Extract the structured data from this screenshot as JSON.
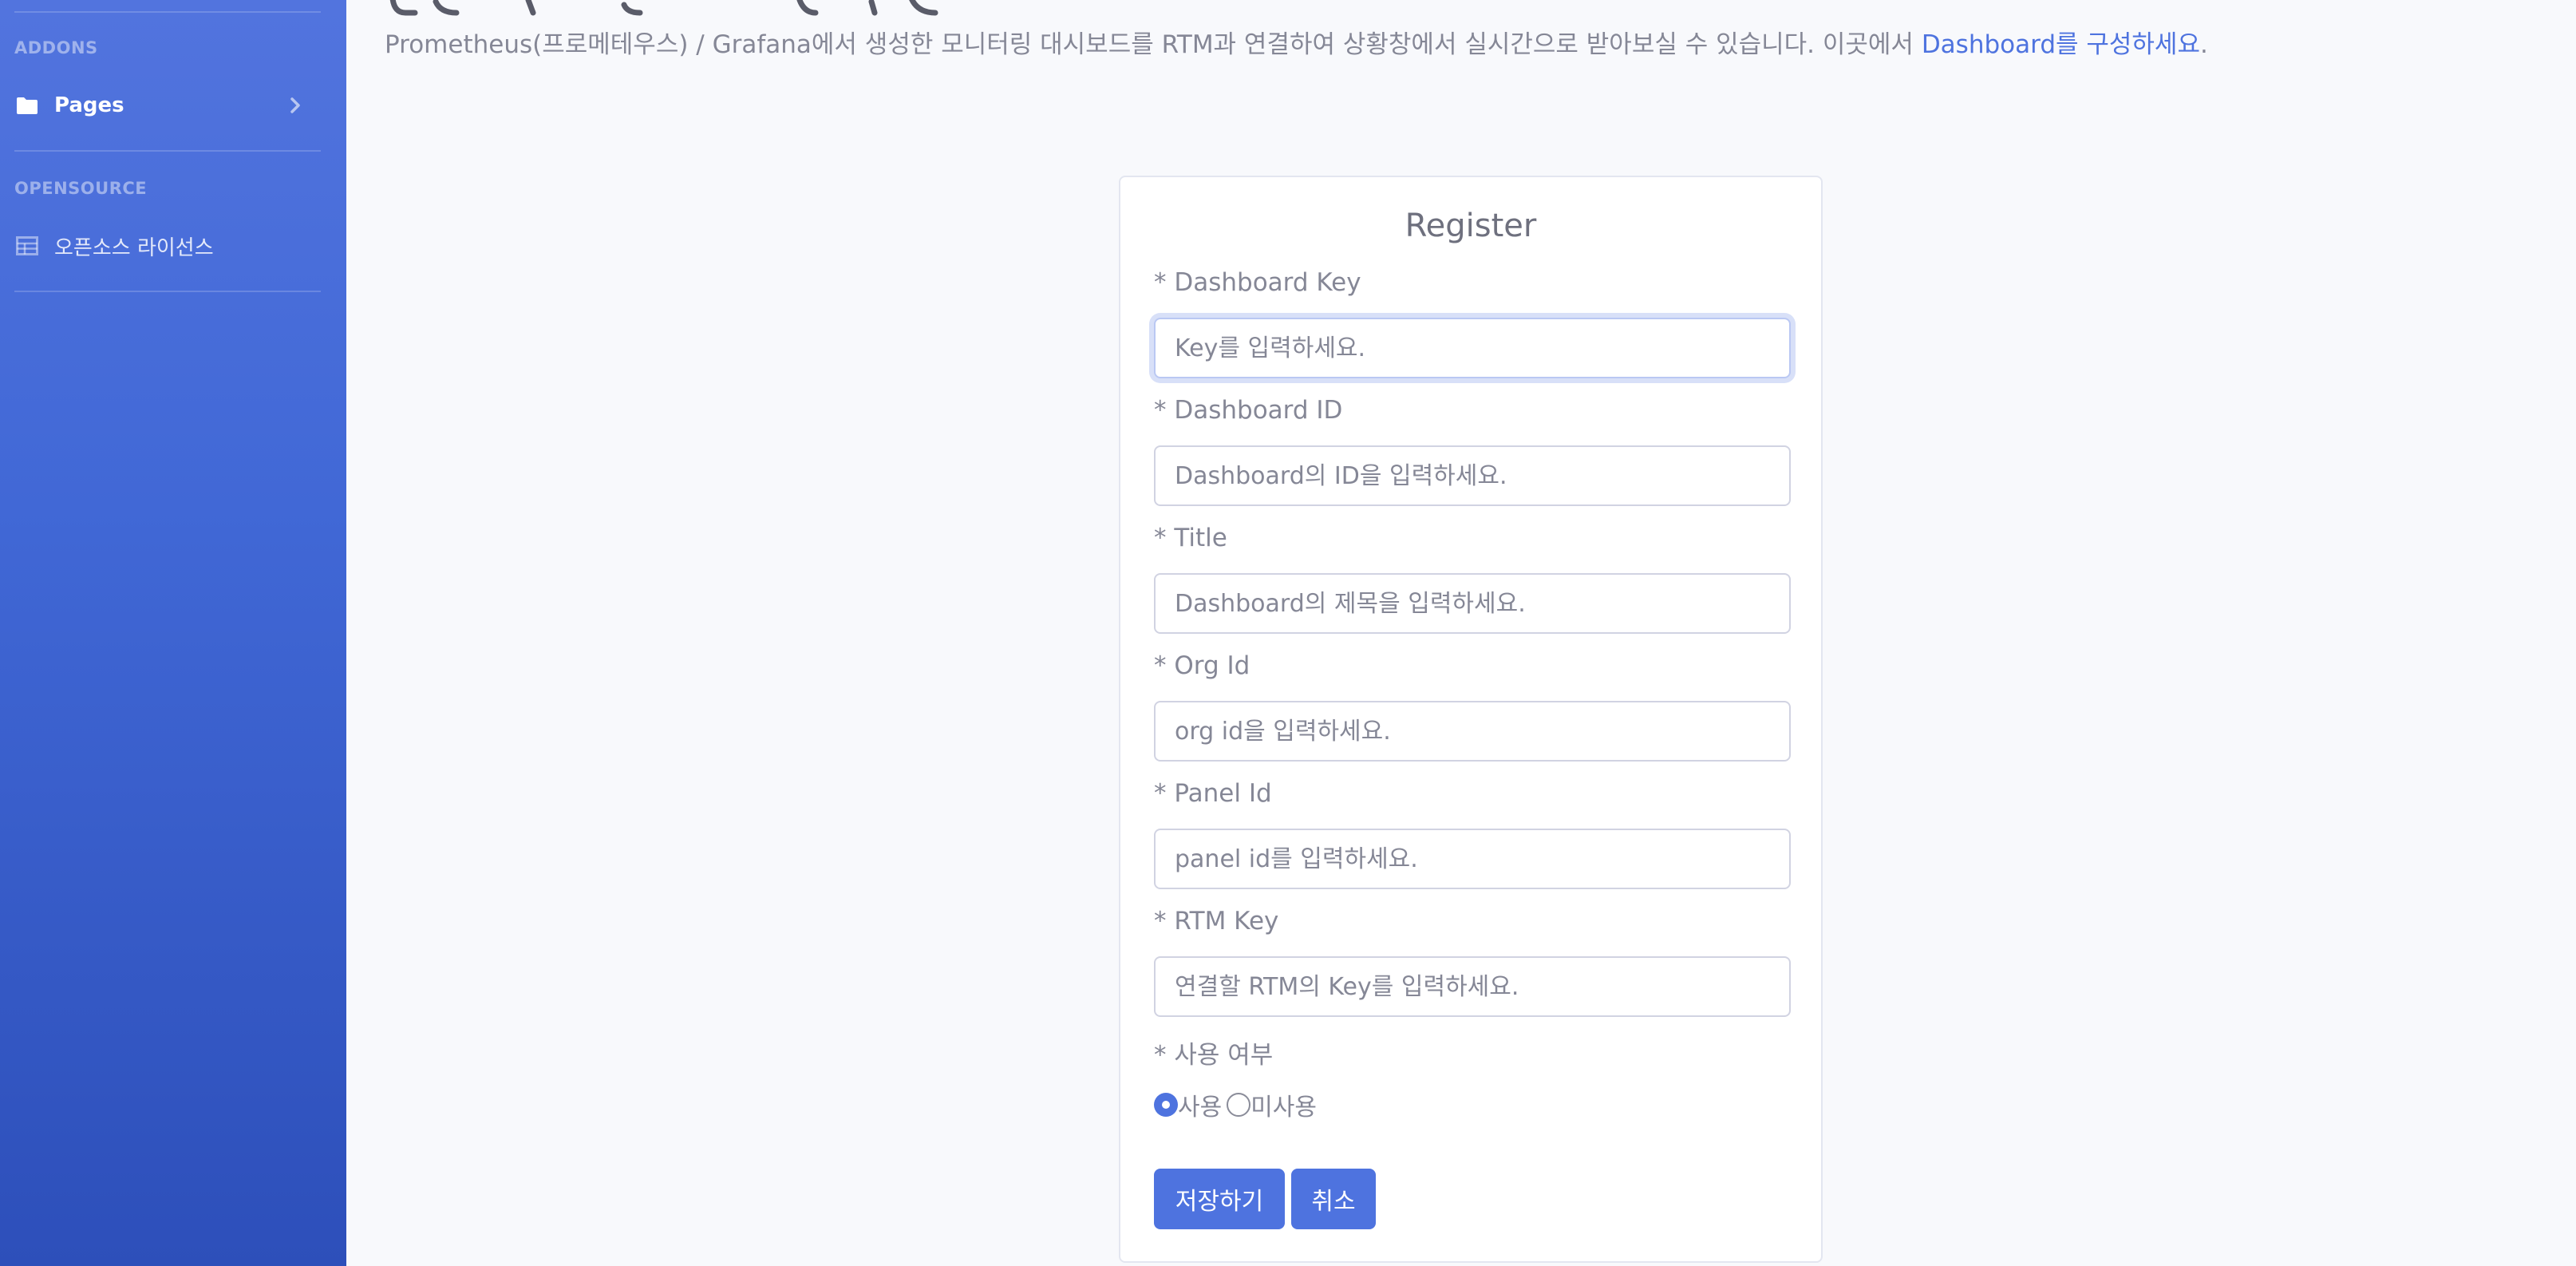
{
  "sidebar": {
    "addons_heading": "ADDONS",
    "pages_label": "Pages",
    "opensource_heading": "OPENSOURCE",
    "license_label": "오픈소스 라이선스"
  },
  "header": {
    "description": "Prometheus(프로메테우스) / Grafana에서 생성한 모니터링 대시보드를 RTM과 연결하여 상황창에서 실시간으로 받아보실 수 있습니다. 이곳에서 ",
    "link_text": "Dashboard를 구성하세요",
    "description_end": "."
  },
  "form": {
    "title": "Register",
    "fields": [
      {
        "label": "* Dashboard Key",
        "placeholder": "Key를 입력하세요."
      },
      {
        "label": "* Dashboard ID",
        "placeholder": "Dashboard의 ID을 입력하세요."
      },
      {
        "label": "* Title",
        "placeholder": "Dashboard의 제목을 입력하세요."
      },
      {
        "label": "* Org Id",
        "placeholder": "org id을 입력하세요."
      },
      {
        "label": "* Panel Id",
        "placeholder": "panel id를 입력하세요."
      },
      {
        "label": "* RTM Key",
        "placeholder": "연결할 RTM의 Key를 입력하세요."
      }
    ],
    "usage_label": "* 사용 여부",
    "radio_use": "사용",
    "radio_unuse": "미사용",
    "save_button": "저장하기",
    "cancel_button": "취소"
  },
  "colors": {
    "primary": "#4e73df",
    "sidebar_top": "#5274de",
    "sidebar_bottom": "#2d4fba",
    "background": "#f8f9fc"
  },
  "icons": {
    "pages": "folder-icon",
    "pages_chevron": "chevron-right-icon",
    "license": "table-icon"
  }
}
